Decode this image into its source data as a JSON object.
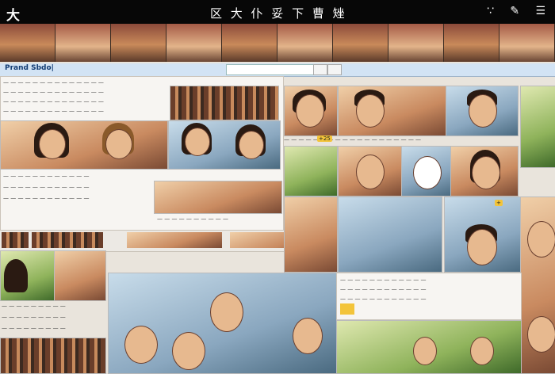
{
  "topbar": {
    "left": "大",
    "center": "区 大 仆 妥 下 曹 矬",
    "right": "∵ ✎ ☰"
  },
  "address_bar": {
    "label": "Prand Sbdo|",
    "field": ""
  },
  "badges": {
    "count": "+25",
    "b2": "+"
  },
  "colors": {
    "topbar": "#070707",
    "address_bar": "#d2e3f4",
    "badge_red": "#c0392b",
    "badge_yellow": "#f3c43a"
  },
  "icons": [
    "menu-icon",
    "edit-icon",
    "tilde-icon",
    "play-icon",
    "close-icon"
  ]
}
